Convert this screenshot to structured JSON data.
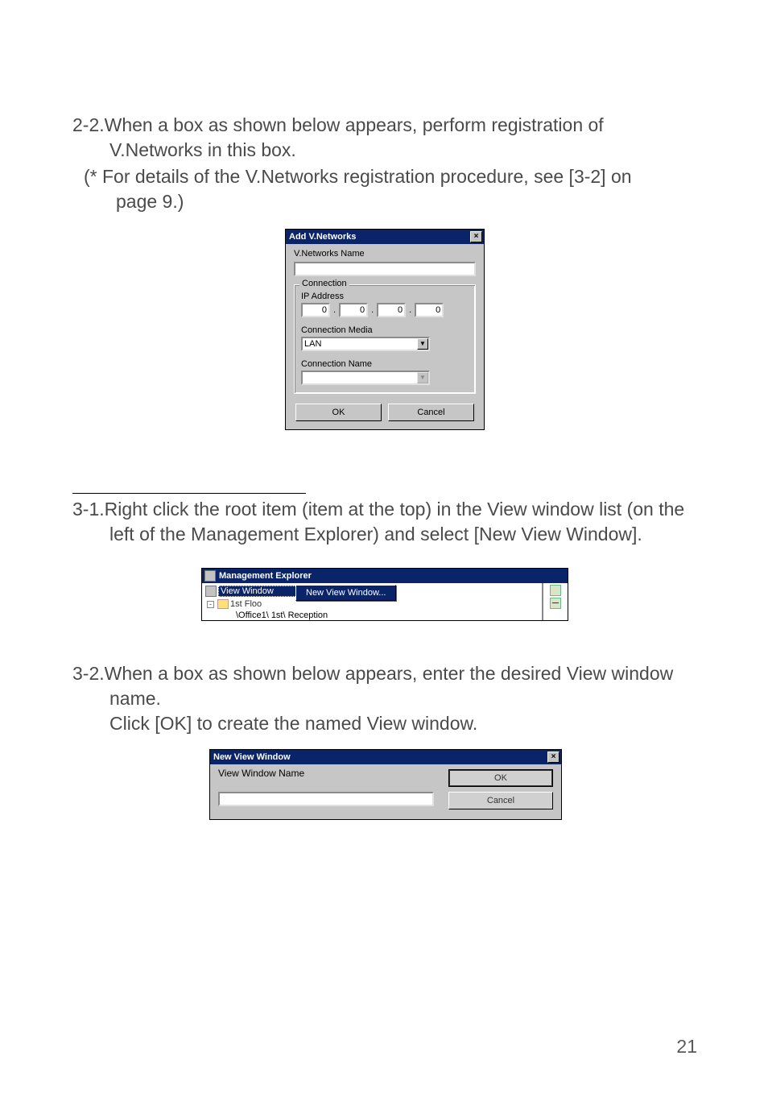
{
  "para_2_2_a": "2-2.When a box as shown below appears, perform registration of V.Networks in this box.",
  "para_2_2_b": "(* For details of the V.Networks registration procedure, see [3-2] on",
  "para_2_2_c": " page 9.)",
  "dlg_add": {
    "title": "Add V.Networks",
    "name_label": "V.Networks Name",
    "name_value": "",
    "group_label": "Connection",
    "ip_label": "IP Address",
    "ip": [
      "0",
      "0",
      "0",
      "0"
    ],
    "media_label": "Connection Media",
    "media_value": "LAN",
    "conn_name_label": "Connection Name",
    "conn_name_value": "",
    "ok": "OK",
    "cancel": "Cancel"
  },
  "para_3_1": "3-1.Right click the root item (item at the top) in the View window list (on the left of the Management Explorer) and select [New View Window].",
  "fig_me": {
    "title": "Management Explorer",
    "root_item": "View Window",
    "child_item": "1st Floo",
    "menu_item": "New View Window...",
    "cutoff": "\\Office1\\ 1st\\ Reception"
  },
  "para_3_2_a": "3-2.When a box as shown below appears, enter the desired View window name.",
  "para_3_2_b": "Click [OK] to create the named View window.",
  "dlg_nvw": {
    "title": "New View Window",
    "label": "View Window Name",
    "value": "",
    "ok": "OK",
    "cancel": "Cancel"
  },
  "page_no": "21"
}
